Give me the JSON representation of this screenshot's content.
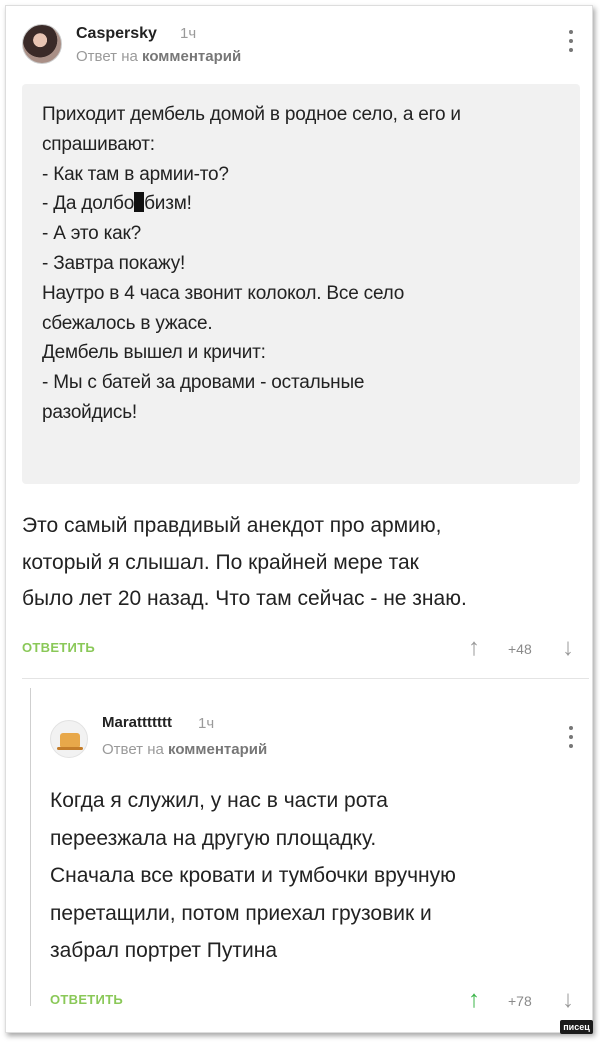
{
  "comment1": {
    "author": "Caspersky",
    "time": "1ч",
    "reply_prefix": "Ответ на ",
    "reply_link": "комментарий",
    "quote_lines": [
      "Приходит дембель домой в родное село, а его и",
      "спрашивают:",
      "- Как там в армии-то?",
      "- Да долбо",
      "бизм!",
      "- А это как?",
      "- Завтра покажу!",
      "Наутро в 4 часа звонит колокол. Все село",
      "сбежалось в ужасе.",
      "Дембель вышел и кричит:",
      "- Мы с батей за дровами - остальные",
      "разойдись!"
    ],
    "body_lines": [
      "Это самый правдивый анекдот про армию,",
      "который я слышал. По крайней мере так",
      "было лет 20 назад. Что там сейчас - не знаю."
    ],
    "reply_label": "ОТВЕТИТЬ",
    "up_arrow": "↑",
    "score": "+48",
    "down_arrow": "↓"
  },
  "comment2": {
    "author": "Marattttttt",
    "time": "1ч",
    "reply_prefix": "Ответ на ",
    "reply_link": "комментарий",
    "body_lines": [
      "Когда я служил, у нас в части рота",
      "переезжала на другую площадку.",
      "Сначала все кровати и тумбочки вручную",
      "перетащили, потом приехал грузовик и",
      "забрал портрет Путина"
    ],
    "reply_label": "ОТВЕТИТЬ",
    "up_arrow": "↑",
    "score": "+78",
    "down_arrow": "↓"
  },
  "watermark": "писец",
  "colors": {
    "accent_green": "#8ac858",
    "meta_gray": "#9a9a9a",
    "quote_bg": "#f1f1f1"
  }
}
